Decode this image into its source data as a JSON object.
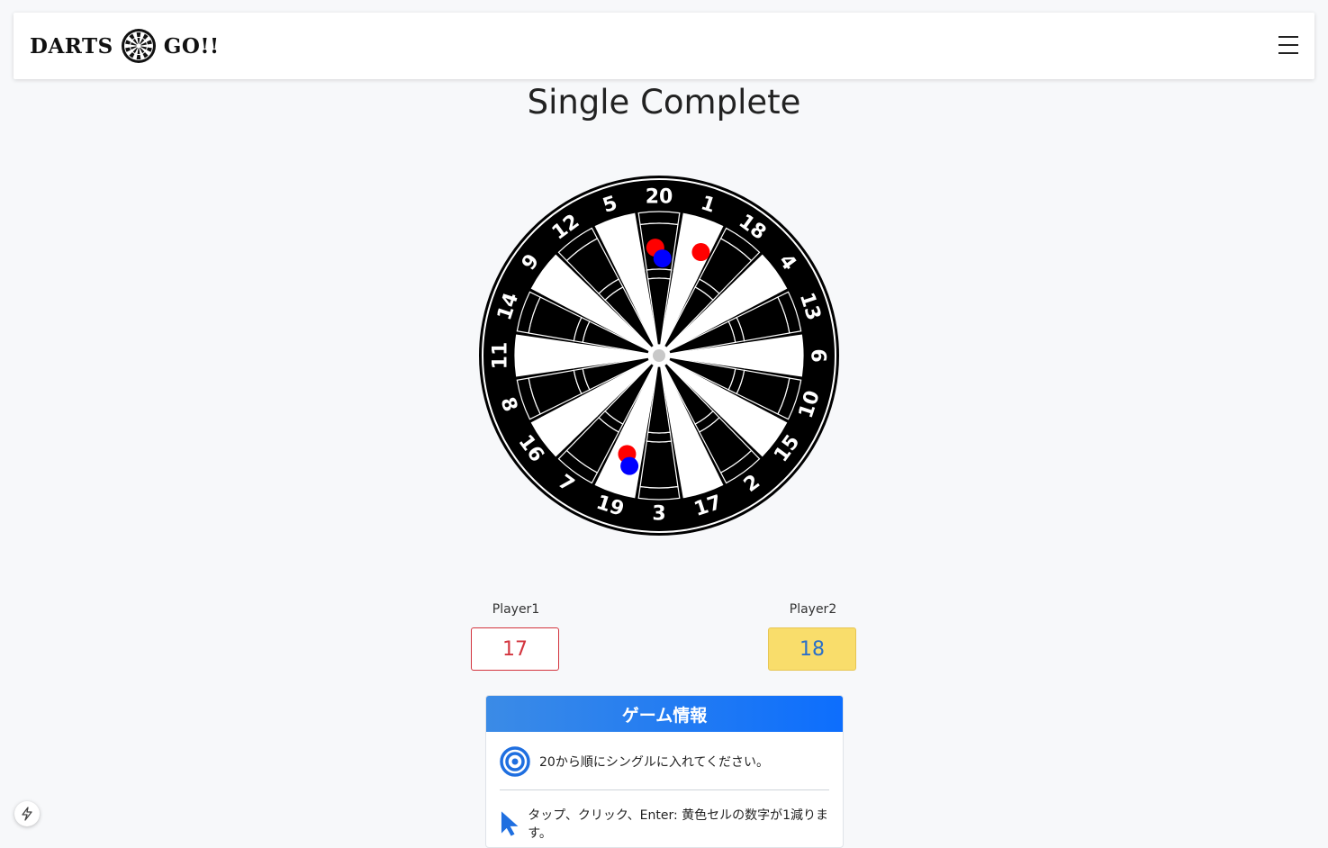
{
  "brand": {
    "left_text": "DARTS",
    "right_text": "GO!!",
    "logo_icon": "dartboard-logo-icon"
  },
  "nav": {
    "menu_icon": "hamburger-menu-icon"
  },
  "page": {
    "title": "Single Complete"
  },
  "dartboard": {
    "numbers": [
      "20",
      "1",
      "18",
      "4",
      "13",
      "6",
      "10",
      "15",
      "2",
      "17",
      "3",
      "19",
      "7",
      "16",
      "8",
      "11",
      "14",
      "9",
      "12",
      "5"
    ],
    "markers": [
      {
        "player": "Player1",
        "color": "#ff0000",
        "segment": "20"
      },
      {
        "player": "Player2",
        "color": "#0000ff",
        "segment": "20"
      },
      {
        "player": "Player1",
        "color": "#ff0000",
        "segment": "1"
      },
      {
        "player": "Player1",
        "color": "#ff0000",
        "segment": "19"
      },
      {
        "player": "Player2",
        "color": "#0000ff",
        "segment": "19"
      }
    ]
  },
  "players": [
    {
      "label": "Player1",
      "score": "17",
      "highlight": false,
      "color": "#d3343e"
    },
    {
      "label": "Player2",
      "score": "18",
      "highlight": true,
      "color": "#2a6fc9"
    }
  ],
  "info": {
    "title": "ゲーム情報",
    "rows": [
      {
        "icon": "target-icon",
        "text": "20から順にシングルに入れてください。"
      },
      {
        "icon": "cursor-icon",
        "text": "タップ、クリック、Enter: 黄色セルの数字が1減ります。"
      }
    ]
  },
  "colors": {
    "accent": "#0d6efd",
    "p1": "#ff0000",
    "p2": "#0000ff",
    "highlight": "#f9dd6b"
  },
  "footer": {
    "badge_icon": "lightning-icon"
  }
}
